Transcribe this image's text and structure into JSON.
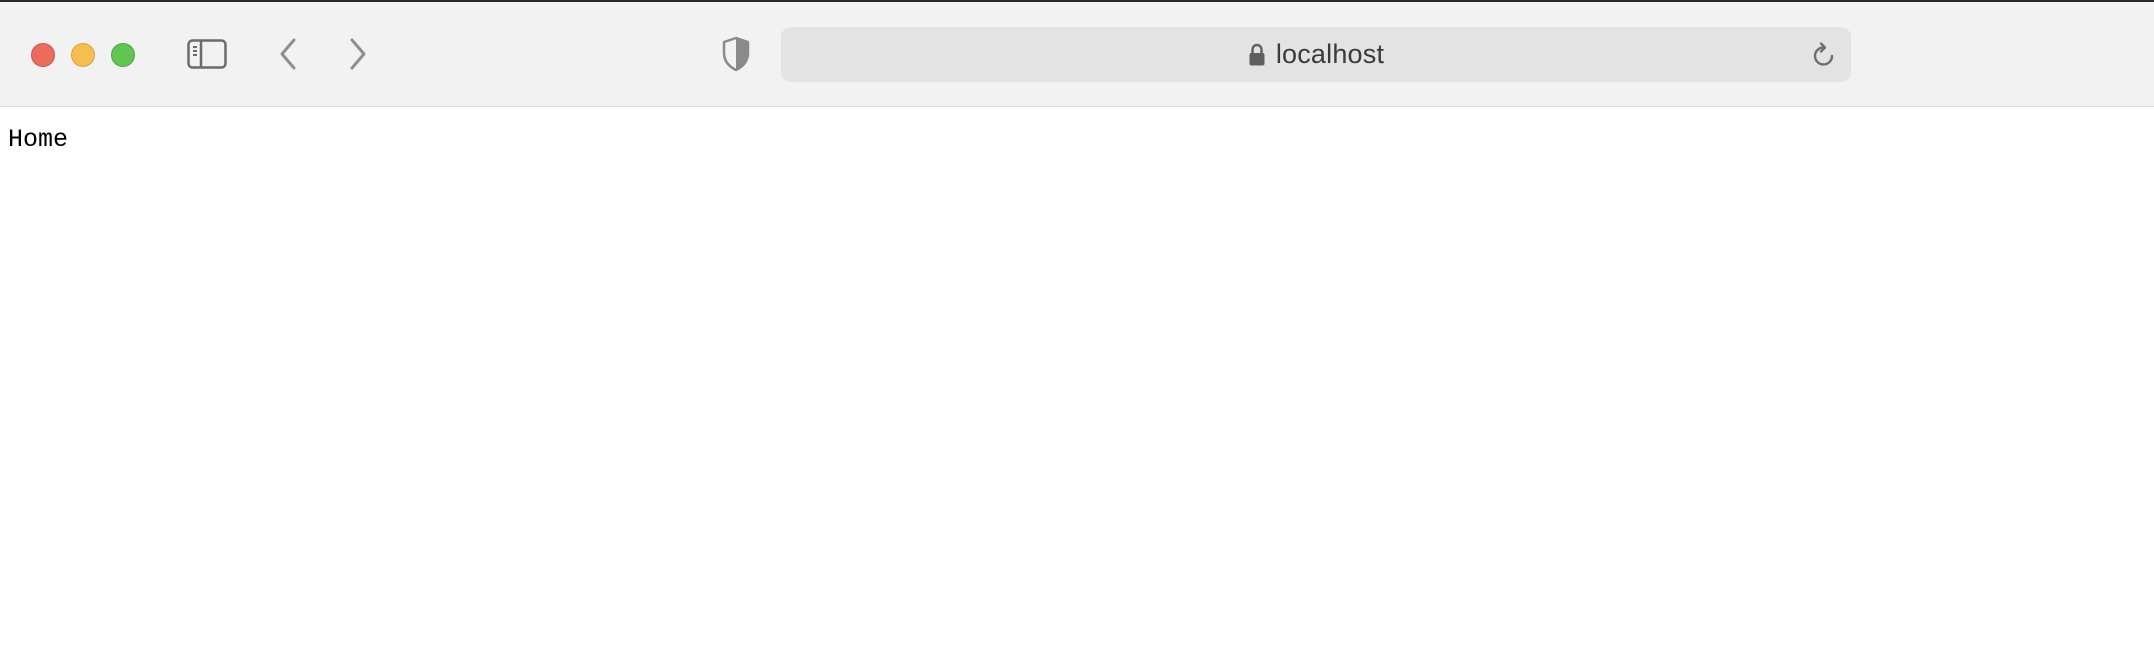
{
  "browser": {
    "address_bar": {
      "url": "localhost",
      "secure_icon": "lock-icon"
    },
    "traffic_lights": {
      "close_color": "#ed6a5e",
      "minimize_color": "#f5bf4f",
      "maximize_color": "#61c554"
    },
    "toolbar_icons": [
      "sidebar-icon",
      "back-chevron-icon",
      "forward-chevron-icon",
      "shield-icon",
      "reload-icon"
    ]
  },
  "page": {
    "link_text": "Home"
  }
}
